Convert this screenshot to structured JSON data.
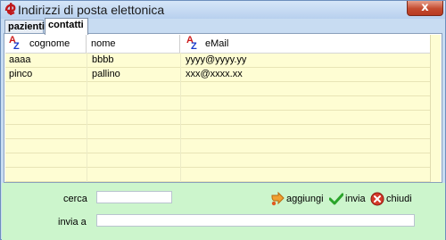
{
  "window": {
    "title": "Indirizzi di posta elettonica",
    "close_glyph": "x"
  },
  "tabs": [
    {
      "label": "pazienti",
      "active": false
    },
    {
      "label": "contatti",
      "active": true
    }
  ],
  "grid": {
    "columns": [
      "cognome",
      "nome",
      "eMail"
    ],
    "rows": [
      {
        "cognome": "aaaa",
        "nome": "bbbb",
        "email": "yyyy@yyyy.yy"
      },
      {
        "cognome": "pinco",
        "nome": "pallino",
        "email": "xxx@xxxx.xx"
      }
    ],
    "row_background": "#fefdd3"
  },
  "form": {
    "cerca_label": "cerca",
    "cerca_value": "",
    "invia_a_label": "invia a",
    "invia_a_value": ""
  },
  "actions": {
    "add_label": "aggiungi",
    "add_icon": "arrow-add-icon",
    "send_label": "invia",
    "send_icon": "checkmark-icon",
    "close_label": "chiudi",
    "close_icon": "close-circle-icon"
  },
  "sort_icon_text": {
    "a": "A",
    "z": "Z"
  },
  "colors": {
    "bottom_panel": "#ccf5cc",
    "accent_red": "#c44b30"
  }
}
